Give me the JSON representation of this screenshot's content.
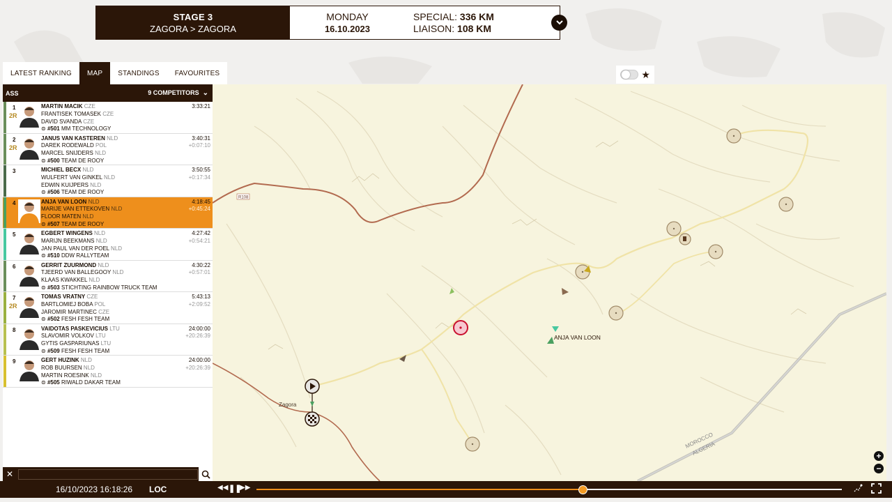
{
  "stage": {
    "title": "STAGE 3",
    "route": "ZAGORA > ZAGORA",
    "day": "MONDAY",
    "date": "16.10.2023",
    "special_label": "SPECIAL:",
    "special_value": "336 KM",
    "liaison_label": "LIAISON:",
    "liaison_value": "108 KM"
  },
  "tabs": [
    {
      "label": "LATEST RANKING"
    },
    {
      "label": "MAP"
    },
    {
      "label": "STANDINGS"
    },
    {
      "label": "FAVOURITES"
    }
  ],
  "panel": {
    "category": "ASS",
    "competitors": "9 COMPETITORS"
  },
  "rows": [
    {
      "pos": "1",
      "tag": "2R",
      "driver": "MARTIN MACIK",
      "driver_nat": "CZE",
      "co1": "FRANTISEK TOMASEK",
      "co1_nat": "CZE",
      "co2": "DAVID SVANDA",
      "co2_nat": "CZE",
      "num": "#501",
      "team": "MM TECHNOLOGY",
      "time": "3:33:21",
      "gap": "",
      "color": "#6a8e5a"
    },
    {
      "pos": "2",
      "tag": "2R",
      "driver": "JANUS VAN KASTEREN",
      "driver_nat": "NLD",
      "co1": "DAREK RODEWALD",
      "co1_nat": "POL",
      "co2": "MARCEL SNIJDERS",
      "co2_nat": "NLD",
      "num": "#500",
      "team": "TEAM DE ROOY",
      "time": "3:40:31",
      "gap": "+0:07:10",
      "color": "#6a8e5a"
    },
    {
      "pos": "3",
      "tag": "",
      "driver": "MICHIEL BECX",
      "driver_nat": "NLD",
      "co1": "WULFERT VAN GINKEL",
      "co1_nat": "NLD",
      "co2": "EDWIN KUIJPERS",
      "co2_nat": "NLD",
      "num": "#506",
      "team": "TEAM DE ROOY",
      "time": "3:50:55",
      "gap": "+0:17:34",
      "color": "#4a6a4a"
    },
    {
      "pos": "4",
      "tag": "",
      "driver": "ANJA VAN LOON",
      "driver_nat": "NLD",
      "co1": "MARIJE VAN ETTEKOVEN",
      "co1_nat": "NLD",
      "co2": "FLOOR MATEN",
      "co2_nat": "NLD",
      "num": "#507",
      "team": "TEAM DE ROOY",
      "time": "4:18:45",
      "gap": "+0:45:24",
      "color": "#4aa060"
    },
    {
      "pos": "5",
      "tag": "",
      "driver": "EGBERT WINGENS",
      "driver_nat": "NLD",
      "co1": "MARIJN BEEKMANS",
      "co1_nat": "NLD",
      "co2": "JAN PAUL VAN DER POEL",
      "co2_nat": "NLD",
      "num": "#510",
      "team": "DDW RALLYTEAM",
      "time": "4:27:42",
      "gap": "+0:54:21",
      "color": "#48c8a0"
    },
    {
      "pos": "6",
      "tag": "",
      "driver": "GERRIT ZUURMOND",
      "driver_nat": "NLD",
      "co1": "TJEERD VAN BALLEGOOY",
      "co1_nat": "NLD",
      "co2": "KLAAS KWAKKEL",
      "co2_nat": "NLD",
      "num": "#503",
      "team": "STICHTING RAINBOW TRUCK TEAM",
      "time": "4:30:22",
      "gap": "+0:57:01",
      "color": "#6a8e5a"
    },
    {
      "pos": "7",
      "tag": "2R",
      "driver": "TOMAS VRATNY",
      "driver_nat": "CZE",
      "co1": "BARTLOMIEJ BOBA",
      "co1_nat": "POL",
      "co2": "JAROMIR MARTINEC",
      "co2_nat": "CZE",
      "num": "#502",
      "team": "FESH FESH TEAM",
      "time": "5:43:13",
      "gap": "+2:09:52",
      "color": "#9ab040"
    },
    {
      "pos": "8",
      "tag": "",
      "driver": "VAIDOTAS PASKEVICIUS",
      "driver_nat": "LTU",
      "co1": "SLAVOMIR VOLKOV",
      "co1_nat": "LTU",
      "co2": "GYTIS GASPARIUNAS",
      "co2_nat": "LTU",
      "num": "#509",
      "team": "FESH FESH TEAM",
      "time": "24:00:00",
      "gap": "+20:26:39",
      "color": "#b8c050"
    },
    {
      "pos": "9",
      "tag": "",
      "driver": "GERT HUZINK",
      "driver_nat": "NLD",
      "co1": "ROB BUURSEN",
      "co1_nat": "NLD",
      "co2": "MARTIN ROESINK",
      "co2_nat": "NLD",
      "num": "#505",
      "team": "RIWALD DAKAR TEAM",
      "time": "24:00:00",
      "gap": "+20:26:39",
      "color": "#d8c030"
    }
  ],
  "map": {
    "road_label": "R108",
    "town_label": "Zagora",
    "competitor_label": "ANJA VAN LOON",
    "border_label_1": "MOROCCO",
    "border_label_2": "ALGERIA",
    "colors": {
      "bg": "#f7f4de",
      "road": "#b26a4f",
      "track": "#f0e3a7",
      "border": "#a7a7a7",
      "accent": "#ee8f1c",
      "dark": "#2b1608"
    }
  },
  "playback": {
    "clock": "16/10/2023 16:18:26",
    "zone": "LOC",
    "progress": 0.557
  },
  "icons": [
    "chevron-down-icon",
    "star-icon",
    "close-icon",
    "search-icon",
    "rewind-icon",
    "pause-icon",
    "forward-icon",
    "path-icon",
    "fullscreen-icon",
    "zoom-in-icon",
    "zoom-out-icon",
    "start-flag-icon",
    "finish-flag-icon",
    "fuel-icon"
  ]
}
